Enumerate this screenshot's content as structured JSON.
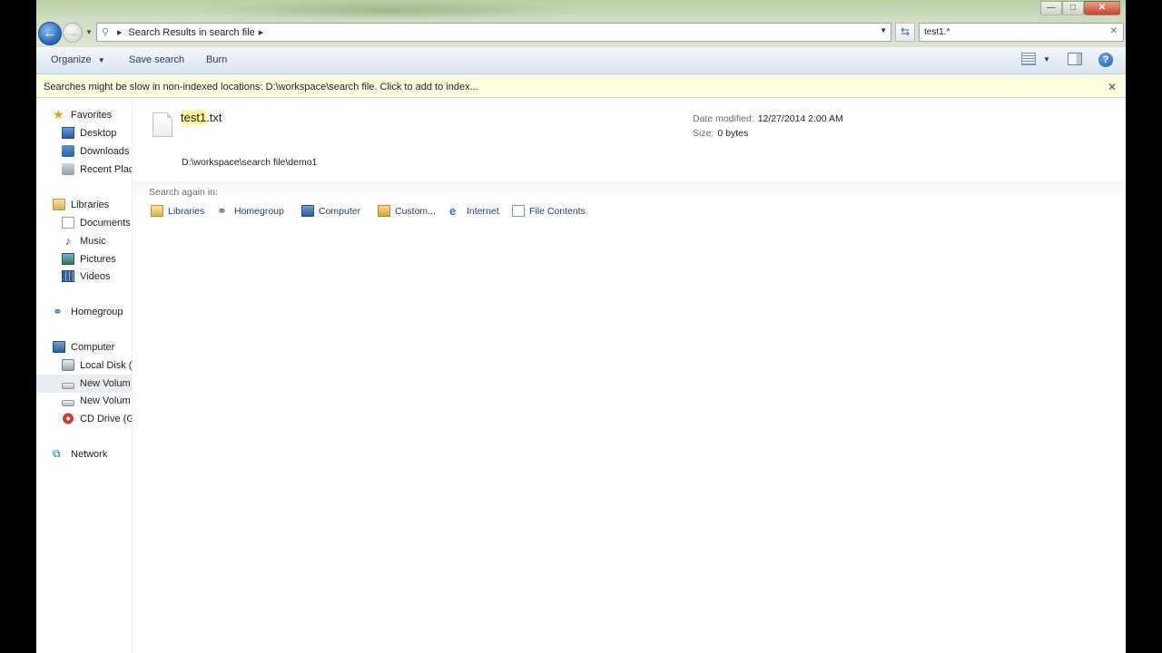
{
  "window": {
    "controls": {
      "minimize": "—",
      "maximize": "□",
      "close": "✕"
    }
  },
  "nav": {
    "back_icon": "back-arrow-icon",
    "forward_icon": "forward-arrow-icon",
    "address": {
      "segments": [
        "Search Results in search file"
      ],
      "icon": "search-icon"
    },
    "search": {
      "value": "test1.*"
    }
  },
  "toolbar": {
    "organize_label": "Organize",
    "save_search_label": "Save search",
    "burn_label": "Burn"
  },
  "infobar": {
    "message": "Searches might be slow in non-indexed locations: D:\\workspace\\search file. Click to add to index..."
  },
  "sidebar": {
    "favorites": {
      "label": "Favorites",
      "items": [
        "Desktop",
        "Downloads",
        "Recent Plac"
      ]
    },
    "libraries": {
      "label": "Libraries",
      "items": [
        "Documents",
        "Music",
        "Pictures",
        "Videos"
      ]
    },
    "homegroup": "Homegroup",
    "computer": {
      "label": "Computer",
      "items": [
        "Local Disk (",
        "New Volum",
        "New Volum",
        "CD Drive (G"
      ]
    },
    "network": "Network"
  },
  "result": {
    "name_highlight": "test1",
    "name_rest": ".txt",
    "date_key": "Date modified:",
    "date_value": "12/27/2014 2:00 AM",
    "size_key": "Size:",
    "size_value": "0 bytes",
    "path": "D:\\workspace\\search file\\demo1"
  },
  "search_again": {
    "label": "Search again in:",
    "items": [
      "Libraries",
      "Homegroup",
      "Computer",
      "Custom...",
      "Internet",
      "File Contents"
    ]
  },
  "colors": {
    "highlight": "#fff59a",
    "infobar": "#ffffe1",
    "toolbar_text": "#1e3a5f"
  }
}
